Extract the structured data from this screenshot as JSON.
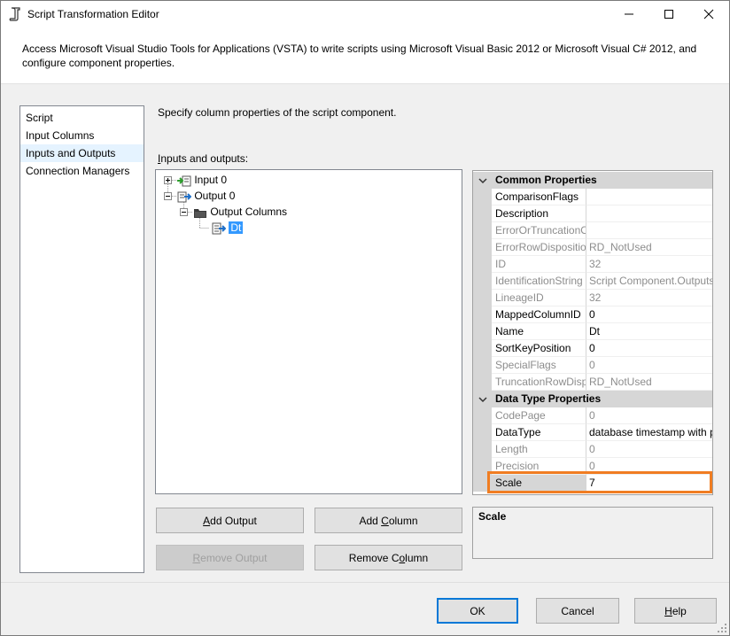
{
  "window": {
    "title": "Script Transformation Editor",
    "minimize_icon": "minimize-icon",
    "maximize_icon": "maximize-icon",
    "close_icon": "close-icon"
  },
  "header": {
    "description": "Access Microsoft Visual Studio Tools for Applications (VSTA) to write scripts using Microsoft Visual Basic 2012 or Microsoft Visual C# 2012, and configure component properties."
  },
  "nav": {
    "items": [
      {
        "label": "Script"
      },
      {
        "label": "Input Columns"
      },
      {
        "label": "Inputs and Outputs",
        "active": true
      },
      {
        "label": "Connection Managers"
      }
    ]
  },
  "main": {
    "instruction": "Specify column properties of the script component.",
    "io_label_prefix": "I",
    "io_label_rest": "nputs and outputs:",
    "tree": {
      "input0": "Input 0",
      "output0": "Output 0",
      "output_columns": "Output Columns",
      "dt": "Dt"
    },
    "buttons": {
      "add_output_u": "A",
      "add_output_rest": "dd Output",
      "add_column_pre": "Add ",
      "add_column_u": "C",
      "add_column_rest": "olumn",
      "remove_output_u": "R",
      "remove_output_rest": "emove Output",
      "remove_column_pre": "Remove C",
      "remove_column_u": "o",
      "remove_column_rest": "lumn"
    }
  },
  "properties": {
    "common_header": "Common Properties",
    "common": [
      {
        "name": "ComparisonFlags",
        "value": "",
        "readonly": false
      },
      {
        "name": "Description",
        "value": "",
        "readonly": false
      },
      {
        "name": "ErrorOrTruncationO",
        "value": "",
        "readonly": true
      },
      {
        "name": "ErrorRowDispositio",
        "value": "RD_NotUsed",
        "readonly": true
      },
      {
        "name": "ID",
        "value": "32",
        "readonly": true
      },
      {
        "name": "IdentificationString",
        "value": "Script Component.Outputs",
        "readonly": true
      },
      {
        "name": "LineageID",
        "value": "32",
        "readonly": true
      },
      {
        "name": "MappedColumnID",
        "value": "0",
        "readonly": false
      },
      {
        "name": "Name",
        "value": "Dt",
        "readonly": false
      },
      {
        "name": "SortKeyPosition",
        "value": "0",
        "readonly": false
      },
      {
        "name": "SpecialFlags",
        "value": "0",
        "readonly": true
      },
      {
        "name": "TruncationRowDisp",
        "value": "RD_NotUsed",
        "readonly": true
      }
    ],
    "datatype_header": "Data Type Properties",
    "datatype": [
      {
        "name": "CodePage",
        "value": "0",
        "readonly": true
      },
      {
        "name": "DataType",
        "value": "database timestamp with p",
        "readonly": false
      },
      {
        "name": "Length",
        "value": "0",
        "readonly": true
      },
      {
        "name": "Precision",
        "value": "0",
        "readonly": true
      },
      {
        "name": "Scale",
        "value": "7",
        "readonly": false,
        "selected": true
      }
    ],
    "description_title": "Scale",
    "highlight_color": "#f07d22"
  },
  "footer": {
    "ok": "OK",
    "cancel": "Cancel",
    "help_u": "H",
    "help_rest": "elp"
  }
}
